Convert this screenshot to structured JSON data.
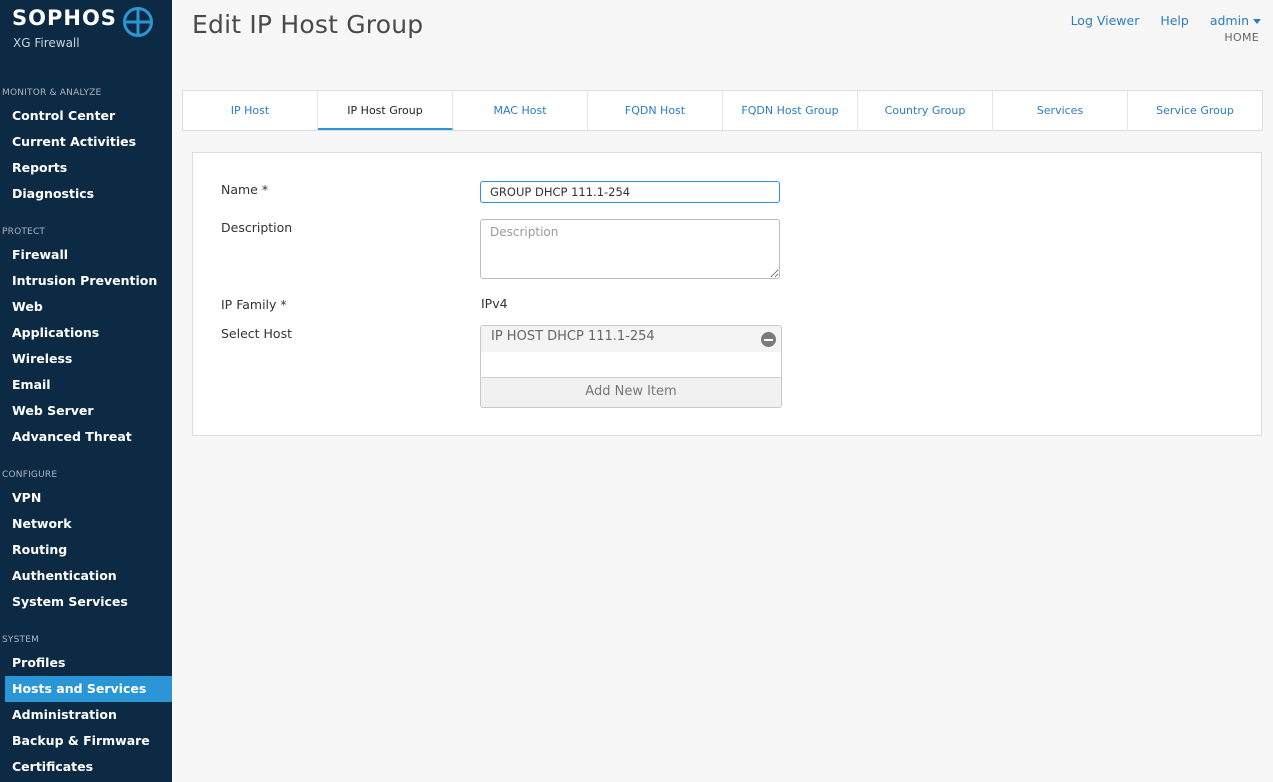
{
  "brand": {
    "name": "SOPHOS",
    "product": "XG Firewall"
  },
  "sidebar": {
    "sections": [
      {
        "title": "MONITOR & ANALYZE",
        "items": [
          "Control Center",
          "Current Activities",
          "Reports",
          "Diagnostics"
        ]
      },
      {
        "title": "PROTECT",
        "items": [
          "Firewall",
          "Intrusion Prevention",
          "Web",
          "Applications",
          "Wireless",
          "Email",
          "Web Server",
          "Advanced Threat"
        ]
      },
      {
        "title": "CONFIGURE",
        "items": [
          "VPN",
          "Network",
          "Routing",
          "Authentication",
          "System Services"
        ]
      },
      {
        "title": "SYSTEM",
        "items": [
          "Profiles",
          "Hosts and Services",
          "Administration",
          "Backup & Firmware",
          "Certificates"
        ]
      }
    ],
    "active_item": "Hosts and Services"
  },
  "header": {
    "title": "Edit IP Host Group",
    "links": {
      "log_viewer": "Log Viewer",
      "help": "Help",
      "admin": "admin"
    },
    "home": "HOME"
  },
  "tabs": [
    "IP Host",
    "IP Host Group",
    "MAC Host",
    "FQDN Host",
    "FQDN Host Group",
    "Country Group",
    "Services",
    "Service Group"
  ],
  "active_tab": "IP Host Group",
  "form": {
    "name_label": "Name *",
    "name_value": "GROUP DHCP 111.1-254",
    "description_label": "Description",
    "description_placeholder": "Description",
    "ip_family_label": "IP Family *",
    "ip_family_value": "IPv4",
    "select_host_label": "Select Host",
    "selected_hosts": [
      "IP HOST DHCP 111.1-254"
    ],
    "add_new_item": "Add New Item"
  },
  "colors": {
    "sidebar_bg": "#0d2a44",
    "accent": "#2b96d6",
    "link": "#2a7dc0"
  }
}
